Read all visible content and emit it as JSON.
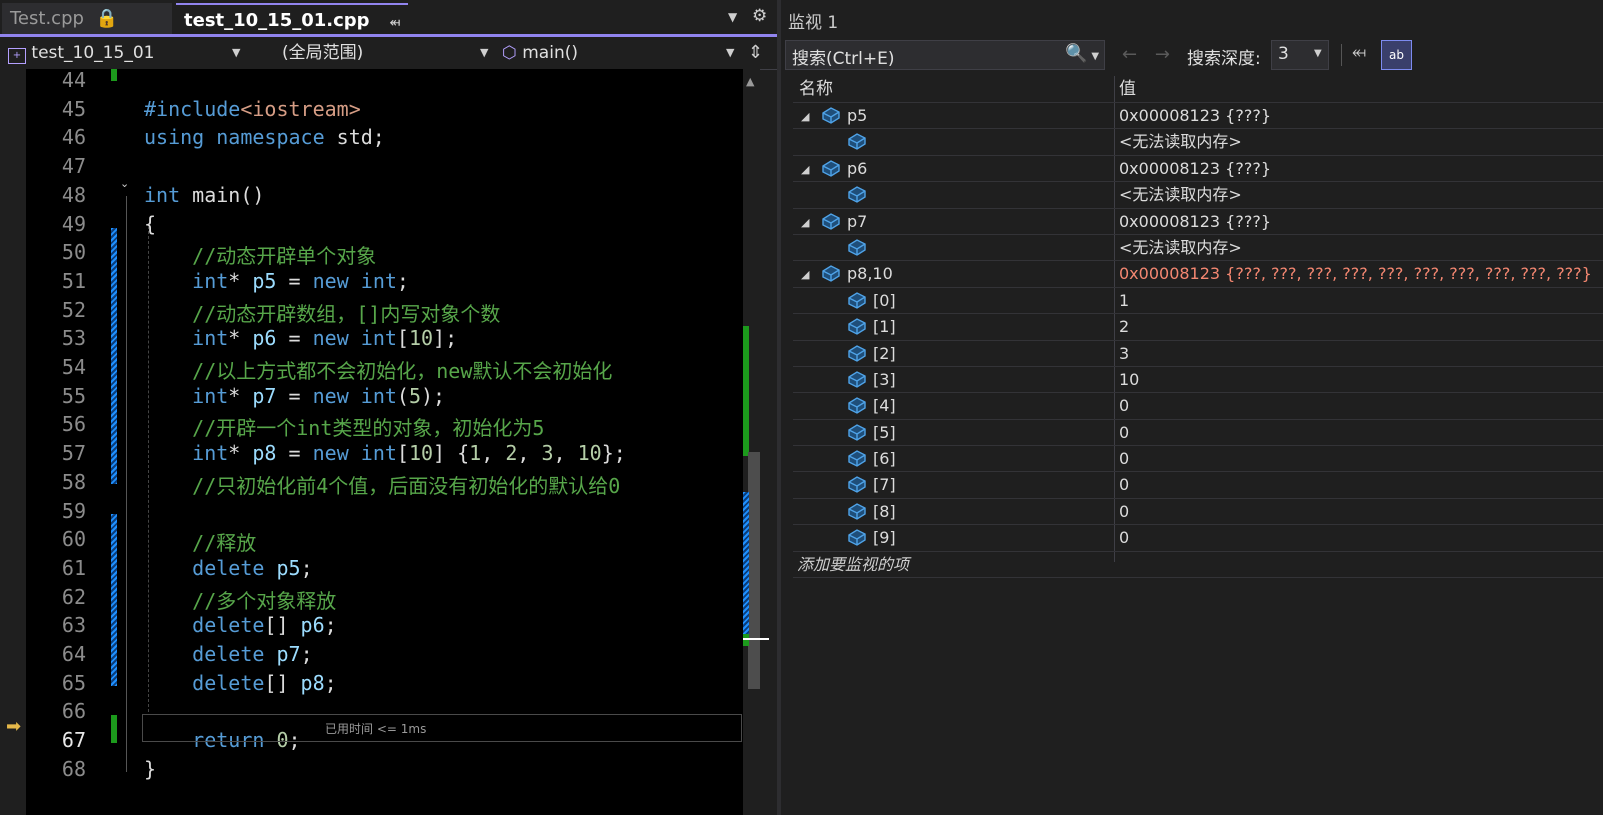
{
  "tabs": [
    {
      "label": "Test.cpp",
      "icon": "lock-icon"
    },
    {
      "label": "test_10_15_01.cpp",
      "icon": "pin-icon"
    }
  ],
  "nav": {
    "project": "test_10_15_01",
    "scope": "(全局范围)",
    "function": "main()"
  },
  "code_lines": [
    {
      "num": "44",
      "html": ""
    },
    {
      "num": "45",
      "html": "<span class='kw'>#include</span><span class='inc'>&lt;iostream&gt;</span>"
    },
    {
      "num": "46",
      "html": "<span class='kw'>using</span> <span class='kw'>namespace</span> std;"
    },
    {
      "num": "47",
      "html": ""
    },
    {
      "num": "48",
      "html": "<span class='kw'>int</span> main()"
    },
    {
      "num": "49",
      "html": "{"
    },
    {
      "num": "50",
      "html": "    <span class='cm'>//动态开辟单个对象</span>"
    },
    {
      "num": "51",
      "html": "    <span class='kw'>int</span>* <span class='var'>p5</span> = <span class='kw'>new</span> <span class='kw'>int</span>;"
    },
    {
      "num": "52",
      "html": "    <span class='cm'>//动态开辟数组，[]内写对象个数</span>"
    },
    {
      "num": "53",
      "html": "    <span class='kw'>int</span>* <span class='var'>p6</span> = <span class='kw'>new</span> <span class='kw'>int</span>[<span class='num'>10</span>];"
    },
    {
      "num": "54",
      "html": "    <span class='cm'>//以上方式都不会初始化，new默认不会初始化</span>"
    },
    {
      "num": "55",
      "html": "    <span class='kw'>int</span>* <span class='var'>p7</span> = <span class='kw'>new</span> <span class='kw'>int</span>(<span class='num'>5</span>);"
    },
    {
      "num": "56",
      "html": "    <span class='cm'>//开辟一个int类型的对象，初始化为5</span>"
    },
    {
      "num": "57",
      "html": "    <span class='kw'>int</span>* <span class='var'>p8</span> = <span class='kw'>new</span> <span class='kw'>int</span>[<span class='num'>10</span>] {<span class='num'>1</span>, <span class='num'>2</span>, <span class='num'>3</span>, <span class='num'>10</span>};"
    },
    {
      "num": "58",
      "html": "    <span class='cm'>//只初始化前4个值，后面没有初始化的默认给0</span>"
    },
    {
      "num": "59",
      "html": ""
    },
    {
      "num": "60",
      "html": "    <span class='cm'>//释放</span>"
    },
    {
      "num": "61",
      "html": "    <span class='kw'>delete</span> <span class='var'>p5</span>;"
    },
    {
      "num": "62",
      "html": "    <span class='cm'>//多个对象释放</span>"
    },
    {
      "num": "63",
      "html": "    <span class='kw'>delete</span>[] <span class='var'>p6</span>;"
    },
    {
      "num": "64",
      "html": "    <span class='kw'>delete</span> <span class='var'>p7</span>;"
    },
    {
      "num": "65",
      "html": "    <span class='kw'>delete</span>[] <span class='var'>p8</span>;"
    },
    {
      "num": "66",
      "html": ""
    },
    {
      "num": "67",
      "html": "    <span class='kw'>return</span> <span class='num'>0</span>;"
    },
    {
      "num": "68",
      "html": "}"
    }
  ],
  "elapsed": "已用时间 <= 1ms",
  "watch": {
    "title": "监视 1",
    "search_placeholder": "搜索(Ctrl+E)",
    "depth_label": "搜索深度:",
    "depth_value": "3",
    "hex_label": "ab",
    "col_name": "名称",
    "col_value": "值",
    "add_item": "添加要监视的项",
    "rows": [
      {
        "name": "p5",
        "value": "0x00008123 {???}",
        "level": 0,
        "expandable": true,
        "red": false
      },
      {
        "name": "",
        "value": "<无法读取内存>",
        "level": 1,
        "expandable": false,
        "red": false
      },
      {
        "name": "p6",
        "value": "0x00008123 {???}",
        "level": 0,
        "expandable": true,
        "red": false
      },
      {
        "name": "",
        "value": "<无法读取内存>",
        "level": 1,
        "expandable": false,
        "red": false
      },
      {
        "name": "p7",
        "value": "0x00008123 {???}",
        "level": 0,
        "expandable": true,
        "red": false
      },
      {
        "name": "",
        "value": "<无法读取内存>",
        "level": 1,
        "expandable": false,
        "red": false
      },
      {
        "name": "p8,10",
        "value": "0x00008123 {???, ???, ???, ???, ???, ???, ???, ???, ???, ???}",
        "level": 0,
        "expandable": true,
        "red": true
      },
      {
        "name": "[0]",
        "value": "1",
        "level": 1,
        "expandable": false,
        "red": false
      },
      {
        "name": "[1]",
        "value": "2",
        "level": 1,
        "expandable": false,
        "red": false
      },
      {
        "name": "[2]",
        "value": "3",
        "level": 1,
        "expandable": false,
        "red": false
      },
      {
        "name": "[3]",
        "value": "10",
        "level": 1,
        "expandable": false,
        "red": false
      },
      {
        "name": "[4]",
        "value": "0",
        "level": 1,
        "expandable": false,
        "red": false
      },
      {
        "name": "[5]",
        "value": "0",
        "level": 1,
        "expandable": false,
        "red": false
      },
      {
        "name": "[6]",
        "value": "0",
        "level": 1,
        "expandable": false,
        "red": false
      },
      {
        "name": "[7]",
        "value": "0",
        "level": 1,
        "expandable": false,
        "red": false
      },
      {
        "name": "[8]",
        "value": "0",
        "level": 1,
        "expandable": false,
        "red": false
      },
      {
        "name": "[9]",
        "value": "0",
        "level": 1,
        "expandable": false,
        "red": false
      }
    ]
  }
}
